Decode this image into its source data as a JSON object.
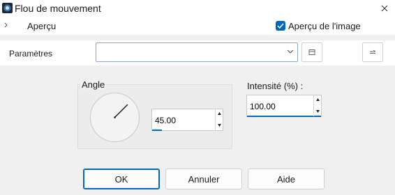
{
  "window": {
    "title": "Flou de mouvement"
  },
  "preview": {
    "label": "Aperçu",
    "show_preview_label": "Aperçu de l'image",
    "show_preview_checked": true
  },
  "parameters": {
    "label": "Paramètres",
    "preset_value": ""
  },
  "angle": {
    "label": "Angle",
    "value": "45.00",
    "degrees": 45
  },
  "intensity": {
    "label": "Intensité (%) :",
    "value": "100.00"
  },
  "buttons": {
    "ok": "OK",
    "cancel": "Annuler",
    "help": "Aide"
  },
  "colors": {
    "accent": "#0067c0"
  },
  "icons": {
    "app": "flou-app-icon",
    "close": "close-icon",
    "expand": "expand-icon",
    "check": "check-icon",
    "dropdown": "chevron-down-icon",
    "save": "save-preset-icon",
    "reset": "reset-preset-icon",
    "spin": "spin-arrows-icon"
  }
}
